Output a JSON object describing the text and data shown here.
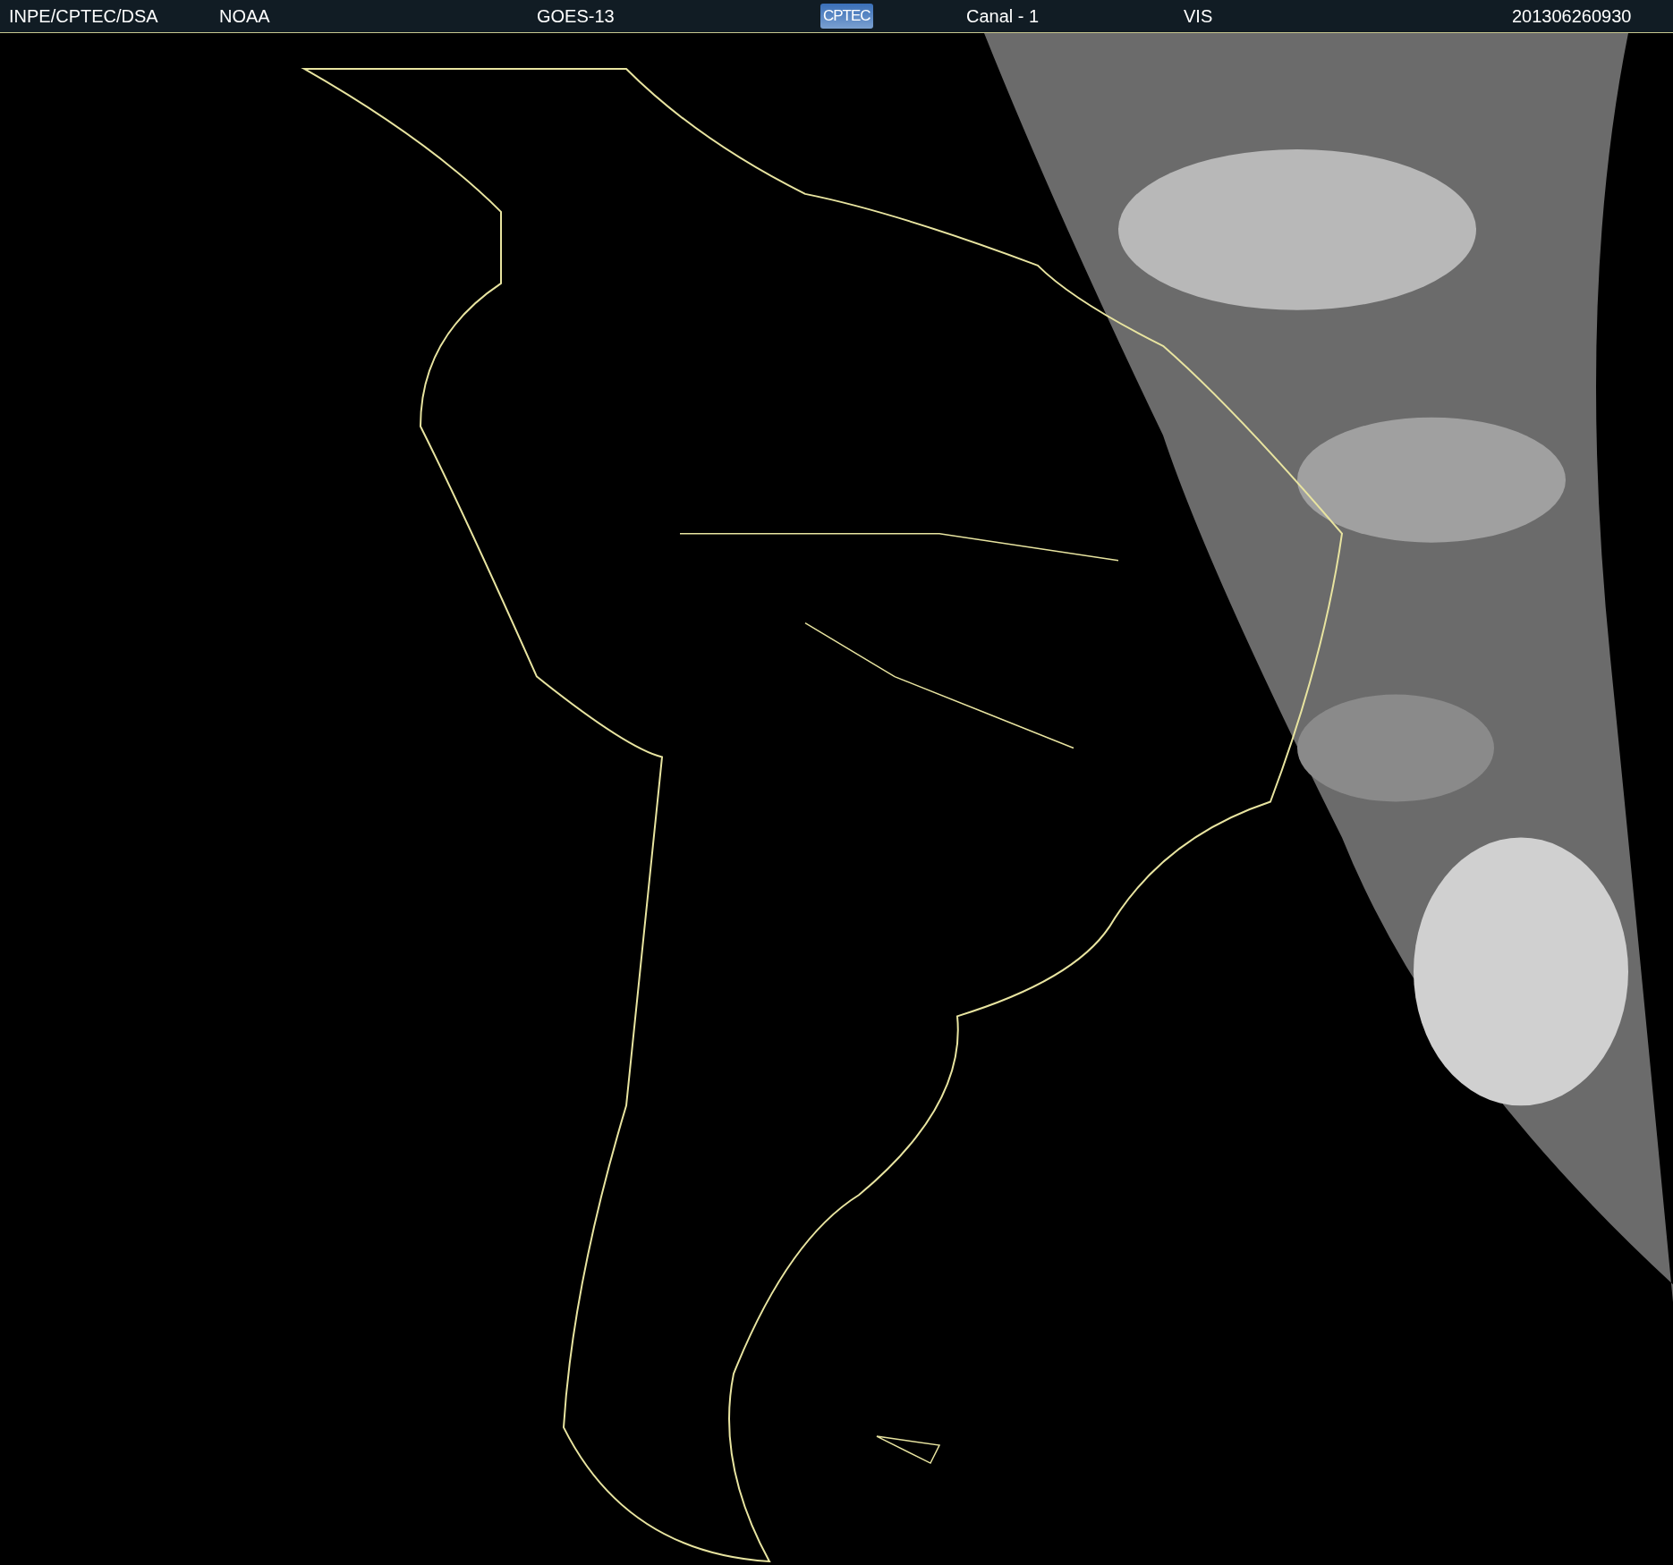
{
  "header": {
    "items": [
      {
        "kind": "text",
        "text": "INPE/CPTEC/DSA"
      },
      {
        "kind": "text",
        "text": "NOAA"
      },
      {
        "kind": "text",
        "text": "GOES-13"
      },
      {
        "kind": "logo",
        "text": "CPTEC"
      },
      {
        "kind": "text",
        "text": "Canal - 1"
      },
      {
        "kind": "text",
        "text": "VIS"
      },
      {
        "kind": "text",
        "text": "201306260930"
      }
    ]
  }
}
